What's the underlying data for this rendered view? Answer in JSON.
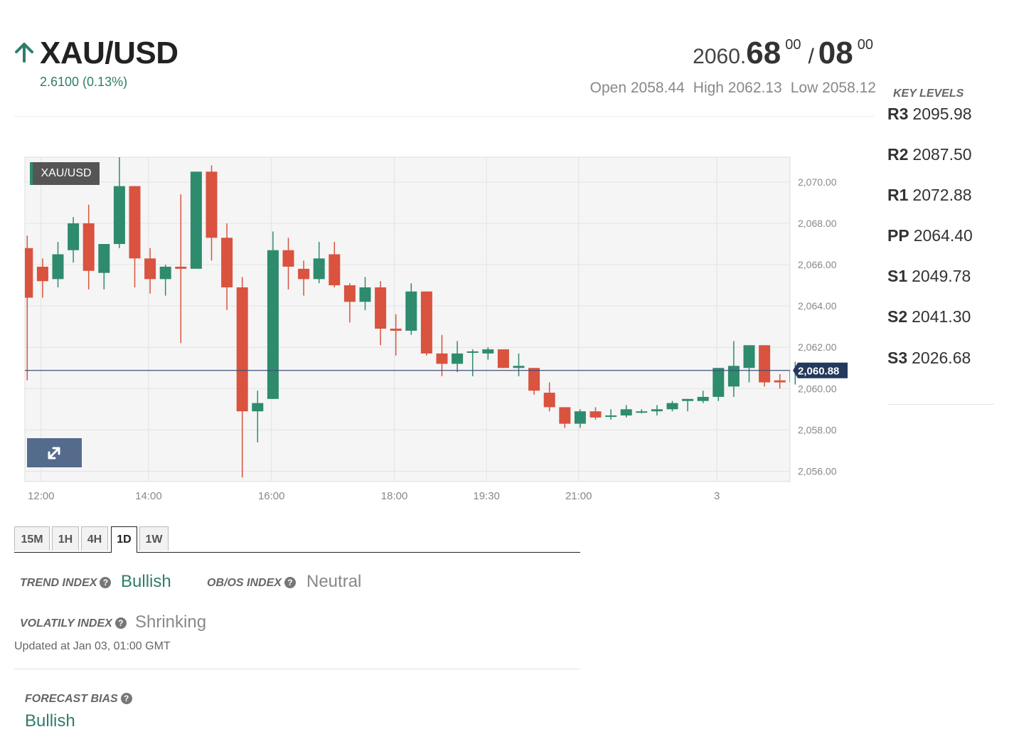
{
  "header": {
    "symbol": "XAU/USD",
    "change": "2.6100 (0.13%)",
    "price": {
      "bid_int": "2060.",
      "bid_dec": "68",
      "bid_sup": "00",
      "slash": "/",
      "ask_dec": "08",
      "ask_sup": "00"
    },
    "open": "Open 2058.44",
    "high": "High 2062.13",
    "low": "Low 2058.12"
  },
  "key_levels": {
    "title": "KEY LEVELS",
    "items": [
      {
        "name": "R3",
        "value": "2095.98"
      },
      {
        "name": "R2",
        "value": "2087.50"
      },
      {
        "name": "R1",
        "value": "2072.88"
      },
      {
        "name": "PP",
        "value": "2064.40"
      },
      {
        "name": "S1",
        "value": "2049.78"
      },
      {
        "name": "S2",
        "value": "2041.30"
      },
      {
        "name": "S3",
        "value": "2026.68"
      }
    ]
  },
  "chart_label": "XAU/USD",
  "chart_data": {
    "type": "candlestick",
    "y_range": [
      2055.5,
      2071.2
    ],
    "y_ticks": [
      "2,070.00",
      "2,068.00",
      "2,066.00",
      "2,064.00",
      "2,062.00",
      "2,060.00",
      "2,058.00",
      "2,056.00"
    ],
    "y_tick_values": [
      2070,
      2068,
      2066,
      2064,
      2062,
      2060,
      2058,
      2056
    ],
    "x_ticks": [
      {
        "label": "12:00",
        "index": 0.9
      },
      {
        "label": "14:00",
        "index": 7.9
      },
      {
        "label": "16:00",
        "index": 15.9
      },
      {
        "label": "18:00",
        "index": 23.9
      },
      {
        "label": "19:30",
        "index": 29.9
      },
      {
        "label": "21:00",
        "index": 35.9
      },
      {
        "label": "3",
        "index": 44.9
      }
    ],
    "current_price": 2060.88,
    "current_price_label": "2,060.88",
    "up_color": "#2e8b6e",
    "down_color": "#d9533f",
    "candles": [
      {
        "o": 2066.8,
        "h": 2067.4,
        "l": 2060.4,
        "c": 2064.4
      },
      {
        "o": 2065.9,
        "h": 2066.3,
        "l": 2064.4,
        "c": 2065.2
      },
      {
        "o": 2065.3,
        "h": 2067.1,
        "l": 2064.9,
        "c": 2066.5
      },
      {
        "o": 2066.7,
        "h": 2068.3,
        "l": 2066.1,
        "c": 2068.0
      },
      {
        "o": 2068.0,
        "h": 2068.9,
        "l": 2064.8,
        "c": 2065.7
      },
      {
        "o": 2065.6,
        "h": 2067.0,
        "l": 2064.8,
        "c": 2067.0
      },
      {
        "o": 2067.0,
        "h": 2071.2,
        "l": 2066.8,
        "c": 2069.8
      },
      {
        "o": 2069.8,
        "h": 2069.8,
        "l": 2064.9,
        "c": 2066.3
      },
      {
        "o": 2066.3,
        "h": 2066.8,
        "l": 2064.6,
        "c": 2065.3
      },
      {
        "o": 2065.3,
        "h": 2066.0,
        "l": 2064.5,
        "c": 2065.9
      },
      {
        "o": 2065.9,
        "h": 2069.4,
        "l": 2062.2,
        "c": 2065.8
      },
      {
        "o": 2065.8,
        "h": 2070.5,
        "l": 2066.0,
        "c": 2070.5
      },
      {
        "o": 2070.5,
        "h": 2070.8,
        "l": 2066.2,
        "c": 2067.3
      },
      {
        "o": 2067.3,
        "h": 2068.0,
        "l": 2063.8,
        "c": 2064.9
      },
      {
        "o": 2064.9,
        "h": 2065.4,
        "l": 2055.7,
        "c": 2058.9
      },
      {
        "o": 2058.9,
        "h": 2059.9,
        "l": 2057.4,
        "c": 2059.3
      },
      {
        "o": 2059.5,
        "h": 2067.6,
        "l": 2059.5,
        "c": 2066.7
      },
      {
        "o": 2066.7,
        "h": 2067.3,
        "l": 2064.8,
        "c": 2065.9
      },
      {
        "o": 2065.8,
        "h": 2066.2,
        "l": 2064.5,
        "c": 2065.3
      },
      {
        "o": 2065.3,
        "h": 2067.1,
        "l": 2065.1,
        "c": 2066.3
      },
      {
        "o": 2066.5,
        "h": 2067.1,
        "l": 2064.9,
        "c": 2065.0
      },
      {
        "o": 2065.0,
        "h": 2065.1,
        "l": 2063.2,
        "c": 2064.2
      },
      {
        "o": 2064.2,
        "h": 2065.4,
        "l": 2063.8,
        "c": 2064.9
      },
      {
        "o": 2064.9,
        "h": 2065.2,
        "l": 2062.1,
        "c": 2062.9
      },
      {
        "o": 2062.9,
        "h": 2063.6,
        "l": 2061.6,
        "c": 2062.8
      },
      {
        "o": 2062.8,
        "h": 2065.1,
        "l": 2062.6,
        "c": 2064.7
      },
      {
        "o": 2064.7,
        "h": 2064.7,
        "l": 2061.6,
        "c": 2061.7
      },
      {
        "o": 2061.7,
        "h": 2062.6,
        "l": 2060.6,
        "c": 2061.2
      },
      {
        "o": 2061.2,
        "h": 2062.3,
        "l": 2060.8,
        "c": 2061.7
      },
      {
        "o": 2061.8,
        "h": 2061.9,
        "l": 2060.6,
        "c": 2061.8
      },
      {
        "o": 2061.7,
        "h": 2062.0,
        "l": 2061.4,
        "c": 2061.9
      },
      {
        "o": 2061.9,
        "h": 2061.9,
        "l": 2061.0,
        "c": 2061.0
      },
      {
        "o": 2061.0,
        "h": 2061.7,
        "l": 2060.6,
        "c": 2061.1
      },
      {
        "o": 2061.0,
        "h": 2061.0,
        "l": 2059.7,
        "c": 2059.9
      },
      {
        "o": 2059.8,
        "h": 2060.3,
        "l": 2058.9,
        "c": 2059.1
      },
      {
        "o": 2059.1,
        "h": 2059.1,
        "l": 2058.1,
        "c": 2058.3
      },
      {
        "o": 2058.3,
        "h": 2059.0,
        "l": 2058.1,
        "c": 2058.9
      },
      {
        "o": 2058.9,
        "h": 2059.1,
        "l": 2058.5,
        "c": 2058.6
      },
      {
        "o": 2058.7,
        "h": 2059.0,
        "l": 2058.5,
        "c": 2058.7
      },
      {
        "o": 2058.7,
        "h": 2059.2,
        "l": 2058.6,
        "c": 2059.0
      },
      {
        "o": 2058.9,
        "h": 2059.0,
        "l": 2058.8,
        "c": 2058.9
      },
      {
        "o": 2058.9,
        "h": 2059.2,
        "l": 2058.7,
        "c": 2059.0
      },
      {
        "o": 2059.0,
        "h": 2059.4,
        "l": 2058.9,
        "c": 2059.3
      },
      {
        "o": 2059.4,
        "h": 2059.5,
        "l": 2058.9,
        "c": 2059.5
      },
      {
        "o": 2059.4,
        "h": 2059.9,
        "l": 2059.3,
        "c": 2059.6
      },
      {
        "o": 2059.6,
        "h": 2060.5,
        "l": 2059.4,
        "c": 2061.0
      },
      {
        "o": 2060.1,
        "h": 2062.3,
        "l": 2059.6,
        "c": 2061.1
      },
      {
        "o": 2061.0,
        "h": 2062.1,
        "l": 2060.3,
        "c": 2062.1
      },
      {
        "o": 2062.1,
        "h": 2062.1,
        "l": 2060.1,
        "c": 2060.3
      },
      {
        "o": 2060.4,
        "h": 2060.7,
        "l": 2060.0,
        "c": 2060.3
      },
      {
        "o": 2060.3,
        "h": 2061.3,
        "l": 2060.2,
        "c": 2060.9
      }
    ]
  },
  "tabs": [
    {
      "label": "15M",
      "active": false
    },
    {
      "label": "1H",
      "active": false
    },
    {
      "label": "4H",
      "active": false
    },
    {
      "label": "1D",
      "active": true
    },
    {
      "label": "1W",
      "active": false
    }
  ],
  "indices": {
    "trend_label": "TREND INDEX",
    "trend_value": "Bullish",
    "obos_label": "OB/OS INDEX",
    "obos_value": "Neutral",
    "volatility_label": "VOLATILY INDEX",
    "volatility_value": "Shrinking",
    "updated": "Updated at Jan 03, 01:00 GMT",
    "forecast_label": "FORECAST BIAS",
    "forecast_value": "Bullish",
    "help_glyph": "?"
  }
}
